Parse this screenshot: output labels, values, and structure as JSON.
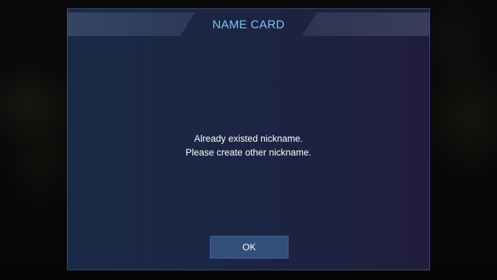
{
  "dialog": {
    "title": "NAME CARD",
    "message_lines": [
      "Already existed nickname.",
      "Please create other nickname."
    ],
    "ok_label": "OK"
  },
  "colors": {
    "title": "#7cc3f2",
    "dialog_bg_left": "#1a2a46",
    "dialog_bg_right": "#221c3c",
    "button_bg": "#314f7a",
    "border": "#3d4d6a"
  }
}
